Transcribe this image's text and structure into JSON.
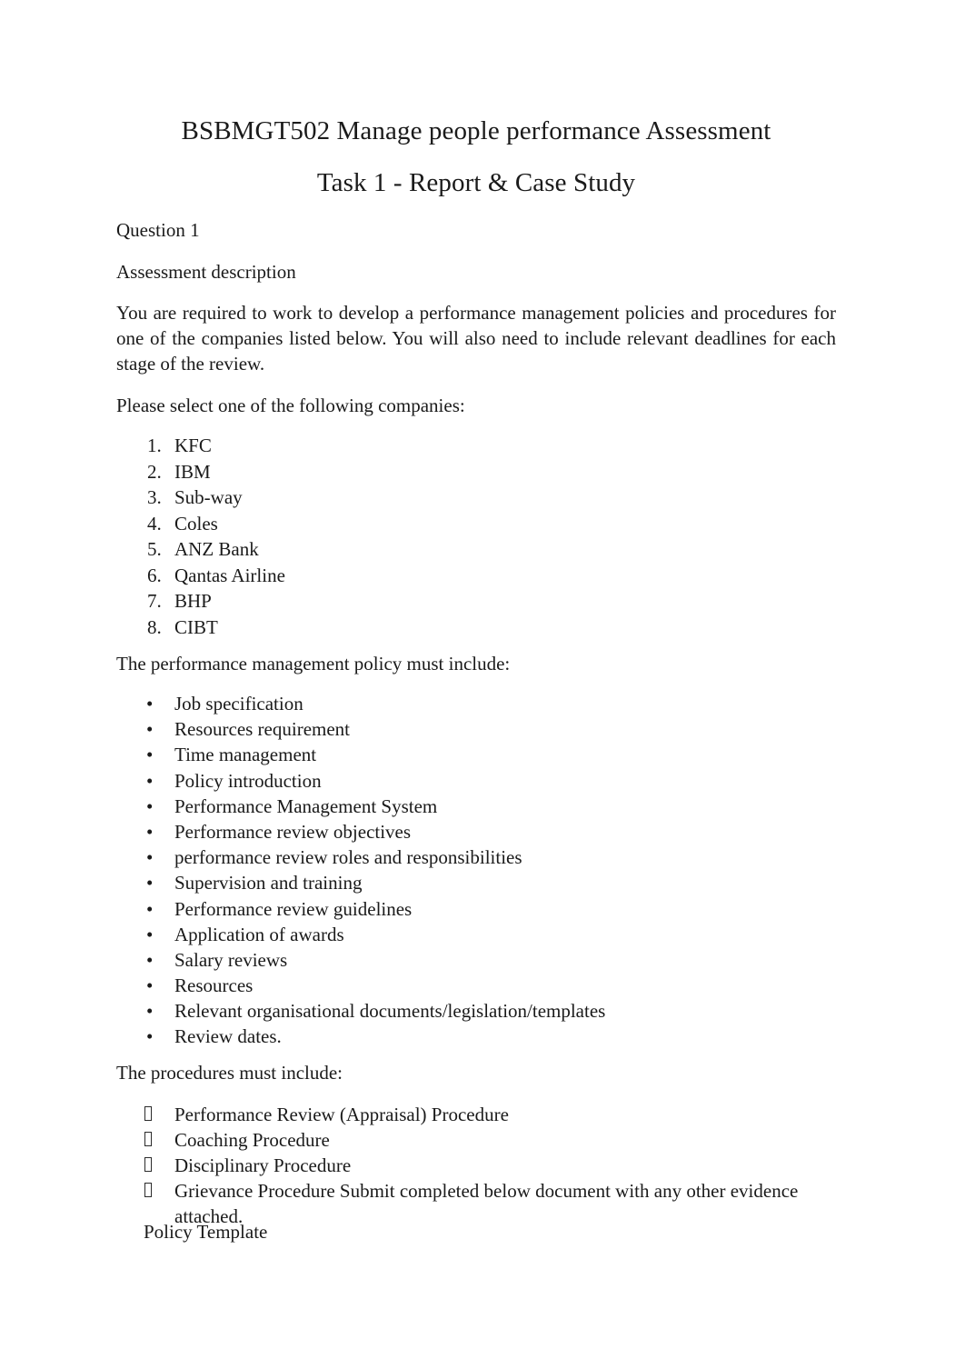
{
  "document": {
    "title_line_1": "BSBMGT502 Manage people performance Assessment",
    "title_line_2": "Task 1 - Report & Case Study",
    "question_label": "Question 1",
    "assessment_description_heading": "Assessment description",
    "description_paragraph": "You are required to work to develop a performance management policies and procedures for one of the companies listed below. You will also need to include relevant deadlines for each stage of the review.",
    "select_company_prompt": "Please select one of the following companies:",
    "policy_include_heading": "The performance management policy must include:",
    "procedures_include_heading": "The procedures must include:",
    "policy_template_label": "Policy Template"
  },
  "companies": [
    {
      "number": "1.",
      "name": "KFC"
    },
    {
      "number": "2.",
      "name": "IBM"
    },
    {
      "number": "3.",
      "name": "Sub-way"
    },
    {
      "number": "4.",
      "name": "Coles"
    },
    {
      "number": "5.",
      "name": "ANZ Bank"
    },
    {
      "number": "6.",
      "name": "Qantas Airline"
    },
    {
      "number": "7.",
      "name": "BHP"
    },
    {
      "number": "8.",
      "name": "CIBT"
    }
  ],
  "policy_items": [
    {
      "bullet": "•",
      "text": "Job specification"
    },
    {
      "bullet": "•",
      "text": "Resources requirement"
    },
    {
      "bullet": "•",
      "text": "Time management"
    },
    {
      "bullet": "•",
      "text": "Policy introduction"
    },
    {
      "bullet": "•",
      "text": "Performance Management System"
    },
    {
      "bullet": "•",
      "text": "Performance review objectives"
    },
    {
      "bullet": "•",
      "text": "performance review roles and responsibilities"
    },
    {
      "bullet": "•",
      "text": "Supervision and training"
    },
    {
      "bullet": "•",
      "text": "Performance review guidelines"
    },
    {
      "bullet": "•",
      "text": "Application of awards"
    },
    {
      "bullet": "•",
      "text": "Salary reviews"
    },
    {
      "bullet": "•",
      "text": "Resources"
    },
    {
      "bullet": "•",
      "text": "Relevant organisational documents/legislation/templates"
    },
    {
      "bullet": "•",
      "text": "Review dates."
    }
  ],
  "procedure_items": [
    {
      "text": "Performance Review (Appraisal) Procedure"
    },
    {
      "text": "Coaching Procedure"
    },
    {
      "text": "Disciplinary Procedure"
    },
    {
      "text": "Grievance Procedure Submit completed below document with any other evidence attached."
    }
  ],
  "colors": {
    "page_background": "#ffffff",
    "text": "#1a1a1a",
    "glyph_box_border": "#2b2b2b"
  }
}
